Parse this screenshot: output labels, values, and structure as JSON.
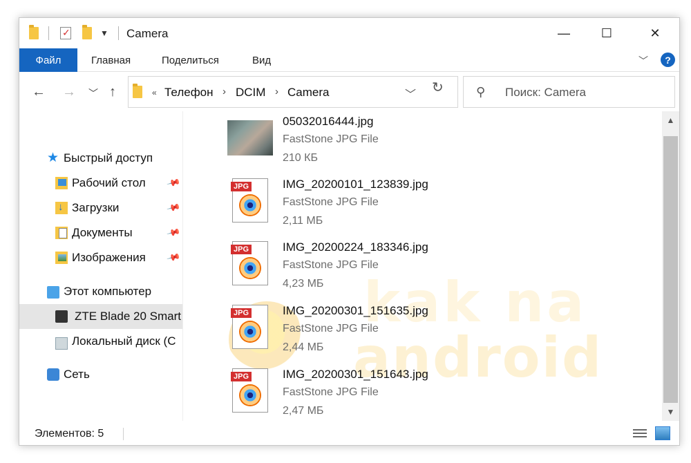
{
  "window": {
    "title": "Camera",
    "controls": {
      "minimize": "—",
      "maximize": "☐",
      "close": "✕"
    }
  },
  "ribbon": {
    "tabs": [
      {
        "label": "Файл",
        "active": true
      },
      {
        "label": "Главная"
      },
      {
        "label": "Поделиться"
      },
      {
        "label": "Вид"
      }
    ],
    "help": "?"
  },
  "address": {
    "crumbs": [
      "Телефон",
      "DCIM",
      "Camera"
    ],
    "search_placeholder": "Поиск: Camera"
  },
  "sidebar": {
    "quick_access": "Быстрый доступ",
    "items": [
      {
        "label": "Рабочий стол",
        "icon": "desktop-folder-icon",
        "pinned": true
      },
      {
        "label": "Загрузки",
        "icon": "downloads-folder-icon",
        "pinned": true
      },
      {
        "label": "Документы",
        "icon": "documents-folder-icon",
        "pinned": true
      },
      {
        "label": "Изображения",
        "icon": "pictures-folder-icon",
        "pinned": true
      }
    ],
    "this_pc": "Этот компьютер",
    "devices": [
      {
        "label": "ZTE Blade 20 Smart",
        "icon": "phone-icon",
        "selected": true
      },
      {
        "label": "Локальный диск (C",
        "icon": "disk-icon"
      }
    ],
    "network": "Сеть"
  },
  "files": [
    {
      "name": "05032016444.jpg",
      "type": "FastStone JPG File",
      "size": "210 КБ",
      "thumbnail": true
    },
    {
      "name": "IMG_20200101_123839.jpg",
      "type": "FastStone JPG File",
      "size": "2,11 МБ"
    },
    {
      "name": "IMG_20200224_183346.jpg",
      "type": "FastStone JPG File",
      "size": "4,23 МБ"
    },
    {
      "name": "IMG_20200301_151635.jpg",
      "type": "FastStone JPG File",
      "size": "2,44 МБ"
    },
    {
      "name": "IMG_20200301_151643.jpg",
      "type": "FastStone JPG File",
      "size": "2,47 МБ"
    }
  ],
  "jpg_badge": "JPG",
  "status": {
    "items": "Элементов: 5"
  },
  "watermark": {
    "line1": "kak na",
    "line2": "android"
  },
  "colors": {
    "accent": "#1565c0",
    "selected_bg": "#e5e5e5",
    "badge_red": "#d32f2f"
  }
}
